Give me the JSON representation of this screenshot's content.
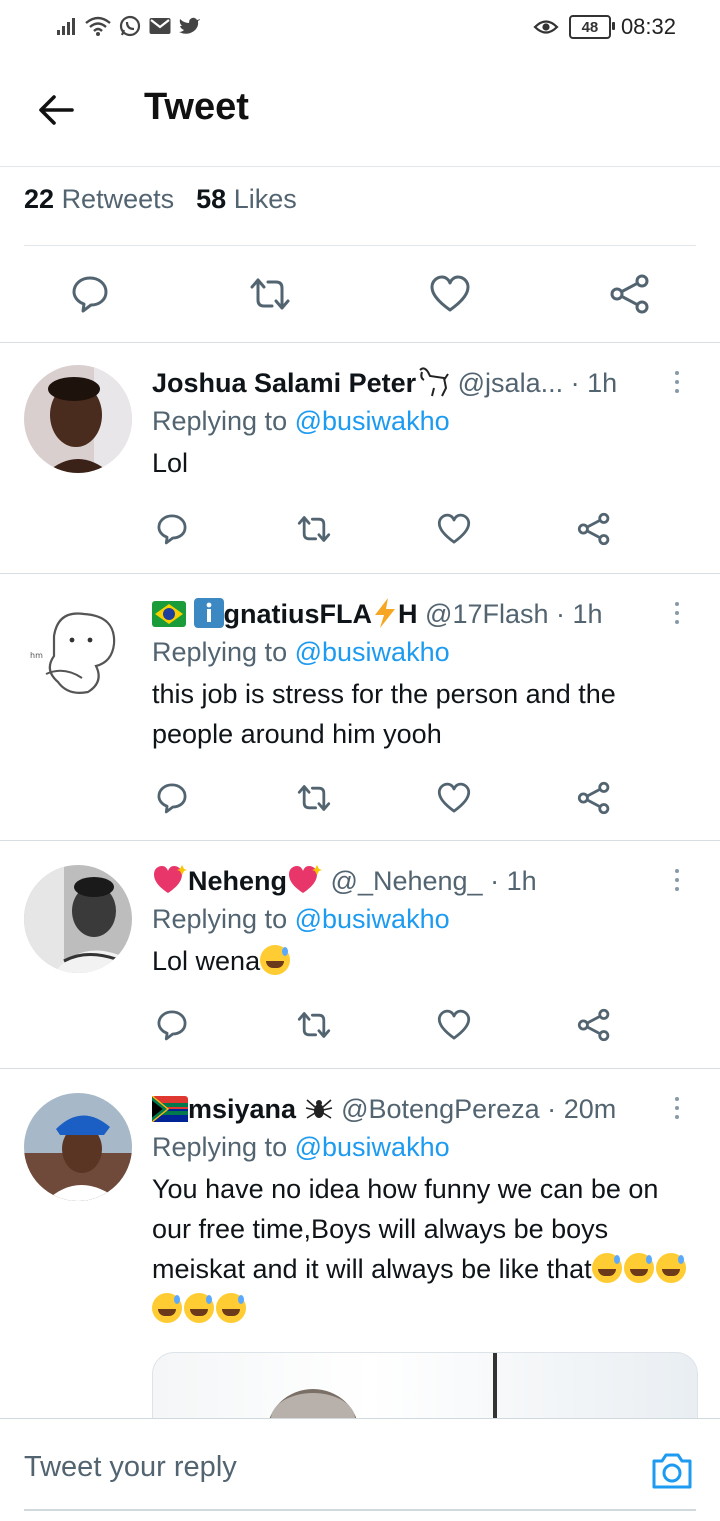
{
  "status_bar": {
    "battery": "48",
    "time": "08:32",
    "icons_left": [
      "signal-icon",
      "wifi-icon",
      "whatsapp-icon",
      "gmail-icon",
      "twitter-icon"
    ],
    "icons_right": [
      "eye-icon",
      "battery-icon"
    ]
  },
  "header": {
    "title": "Tweet"
  },
  "stats": {
    "retweets_count": "22",
    "retweets_label": "Retweets",
    "likes_count": "58",
    "likes_label": "Likes"
  },
  "replies": [
    {
      "name": "Joshua Salami Peter",
      "handle": "@jsala...",
      "time": "1h",
      "replying_prefix": "Replying to",
      "replying_to": "@busiwakho",
      "text": "Lol"
    },
    {
      "name": "gnatiusFLA",
      "name_suffix": "H",
      "handle": "@17Flash",
      "time": "1h",
      "replying_prefix": "Replying to",
      "replying_to": "@busiwakho",
      "text": "this job is stress for the person and the people around him yooh"
    },
    {
      "name": "Neheng",
      "handle": "@_Neheng_",
      "time": "1h",
      "replying_prefix": "Replying to",
      "replying_to": "@busiwakho",
      "text": "Lol wena"
    },
    {
      "name": "msiyana",
      "handle": "@BotengPereza",
      "time": "20m",
      "replying_prefix": "Replying to",
      "replying_to": "@busiwakho",
      "text": "You have no idea how funny we can be on our free time,Boys will always be boys meiskat and it will always be like that"
    }
  ],
  "composer": {
    "placeholder": "Tweet your reply"
  },
  "colors": {
    "accent": "#1d9bf0",
    "text": "#0f1419",
    "muted": "#536471",
    "divider": "#e1e8ed"
  }
}
